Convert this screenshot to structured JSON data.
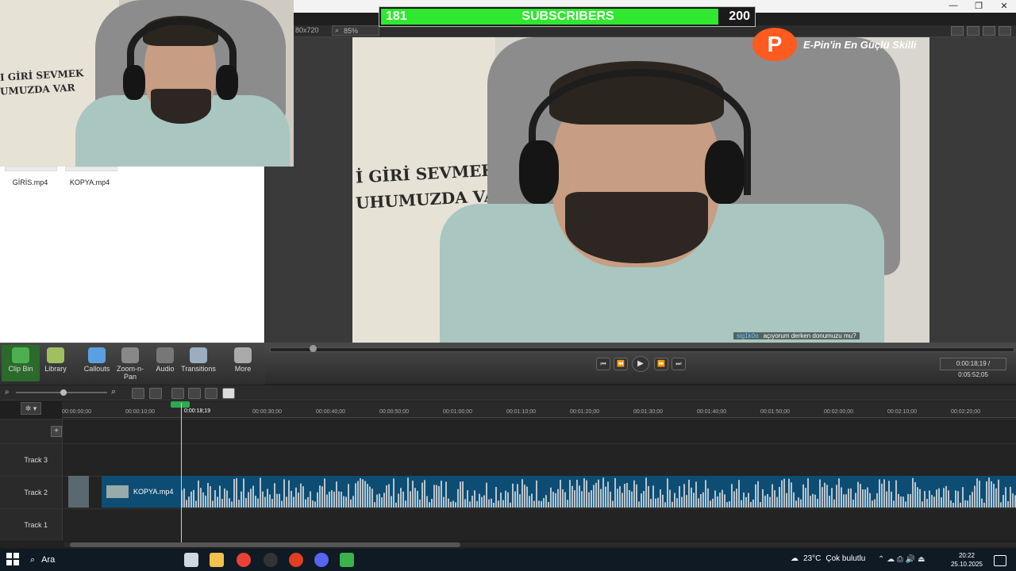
{
  "window": {
    "min_symbol": "—",
    "restore_symbol": "❐",
    "close_symbol": "✕"
  },
  "editor": {
    "dimensions": "80x720",
    "zoom": "85%"
  },
  "overlay": {
    "subscriber_count": "181",
    "subscriber_label": "SUBSCRIBERS",
    "subscriber_goal": "200",
    "progress": 0.905
  },
  "brand": {
    "logo_letter": "P",
    "text": "E-Pin'in En Güçlü Skilli"
  },
  "webcam_poster": {
    "line1": "I GİRİ SEVMEK",
    "line2": "UMUZDA VAR"
  },
  "preview_poster": {
    "line1": "İ GİRİ SEVMEK",
    "line2": "UHUMUZDA VAR"
  },
  "caption": {
    "user": "sig1k0o",
    "message": "açıyorum derken donumuzu mu?"
  },
  "clip_bin": {
    "clips": [
      "GİRİS.mp4",
      "KOPYA.mp4"
    ]
  },
  "tasks": [
    {
      "label": "Clip Bin",
      "color": "#4caf50"
    },
    {
      "label": "Library",
      "color": "#9fbf60"
    },
    {
      "label": "Callouts",
      "color": "#5aa0e0"
    },
    {
      "label": "Zoom-n-Pan",
      "color": "#888888"
    },
    {
      "label": "Audio",
      "color": "#777777"
    },
    {
      "label": "Transitions",
      "color": "#9aaec0"
    },
    {
      "label": "More",
      "color": "#aaaaaa"
    }
  ],
  "player": {
    "time": "0:00:18;19 / 0:05:52;05",
    "prev_symbol": "⏮",
    "rew_symbol": "⏪",
    "play_symbol": "▶",
    "ff_symbol": "⏩",
    "next_symbol": "⏭"
  },
  "timeline": {
    "ruler": [
      "00:00:00;00",
      "00:00:10;00",
      "00:00:30;00",
      "00:00:40;00",
      "00:00:50;00",
      "00:01:00;00",
      "00:01:10;00",
      "00:01:20;00",
      "00:01:30;00",
      "00:01:40;00",
      "00:01:50;00",
      "00:02:00;00",
      "00:02:10;00",
      "00:02:20;00"
    ],
    "playhead_label": "0:00:18;19",
    "gear_symbol": "✲ ▾",
    "add_symbol": "+",
    "tracks": [
      "Track 3",
      "Track 2",
      "Track 1"
    ],
    "clip_name": "KOPYA.mp4"
  },
  "taskbar": {
    "search_placeholder": "Ara",
    "search_icon": "⌕",
    "weather_temp": "23°C",
    "weather_text": "Çok bulutlu",
    "time": "20:22",
    "date": "25.10.2025",
    "tray_symbols": "⌃ ☁ ⎙ 🔊 ⏏",
    "icons": [
      {
        "name": "task-view-icon",
        "color": "#cfd8e0"
      },
      {
        "name": "file-explorer-icon",
        "color": "#f2c14e"
      },
      {
        "name": "chrome-icon",
        "color": "#e94235"
      },
      {
        "name": "app-icon",
        "color": "#333333"
      },
      {
        "name": "game-icon",
        "color": "#e04020"
      },
      {
        "name": "discord-icon",
        "color": "#5865f2"
      },
      {
        "name": "camtasia-icon",
        "color": "#3bb34a"
      }
    ]
  }
}
